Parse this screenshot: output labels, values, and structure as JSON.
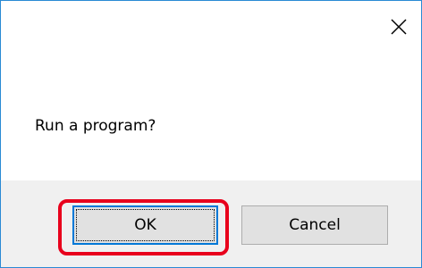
{
  "dialog": {
    "message": "Run a program?",
    "close_label": "close",
    "buttons": {
      "ok_label": "OK",
      "cancel_label": "Cancel"
    },
    "accent_color": "#0078d7",
    "highlight_color": "#e8001c",
    "focused_button": "OK"
  }
}
